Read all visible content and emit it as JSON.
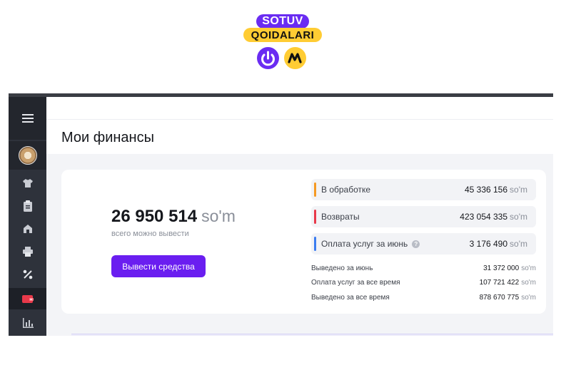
{
  "logo": {
    "line1": "SOTUV",
    "line2": "QOIDALARI"
  },
  "colors": {
    "accent": "#6a1ef0",
    "processing": "#f59a23",
    "returns": "#e8394a",
    "services": "#3b7cf0",
    "sidebar": "#2e323b"
  },
  "sidebar": {
    "items": [
      {
        "icon": "menu-icon"
      },
      {
        "icon": "avatar"
      },
      {
        "icon": "tshirt-icon"
      },
      {
        "icon": "clipboard-icon"
      },
      {
        "icon": "shop-icon"
      },
      {
        "icon": "printer-icon"
      },
      {
        "icon": "percent-icon"
      },
      {
        "icon": "wallet-icon",
        "active": true
      },
      {
        "icon": "chart-icon"
      }
    ]
  },
  "page": {
    "title": "Мои финансы"
  },
  "balance": {
    "amount": "26 950 514",
    "currency": "so'm",
    "caption": "всего можно вывести",
    "button_label": "Вывести средства"
  },
  "stats": [
    {
      "label": "В обработке",
      "value": "45 336 156",
      "currency": "so'm"
    },
    {
      "label": "Возвраты",
      "value": "423 054 335",
      "currency": "so'm"
    },
    {
      "label": "Оплата услуг за июнь",
      "value": "3 176 490",
      "currency": "so'm",
      "help_icon": "?"
    }
  ],
  "summary": [
    {
      "label": "Выведено за июнь",
      "value": "31 372 000",
      "currency": "so'm"
    },
    {
      "label": "Оплата услуг за все время",
      "value": "107 721 422",
      "currency": "so'm"
    },
    {
      "label": "Выведено за все время",
      "value": "878 670 775",
      "currency": "so'm"
    }
  ]
}
